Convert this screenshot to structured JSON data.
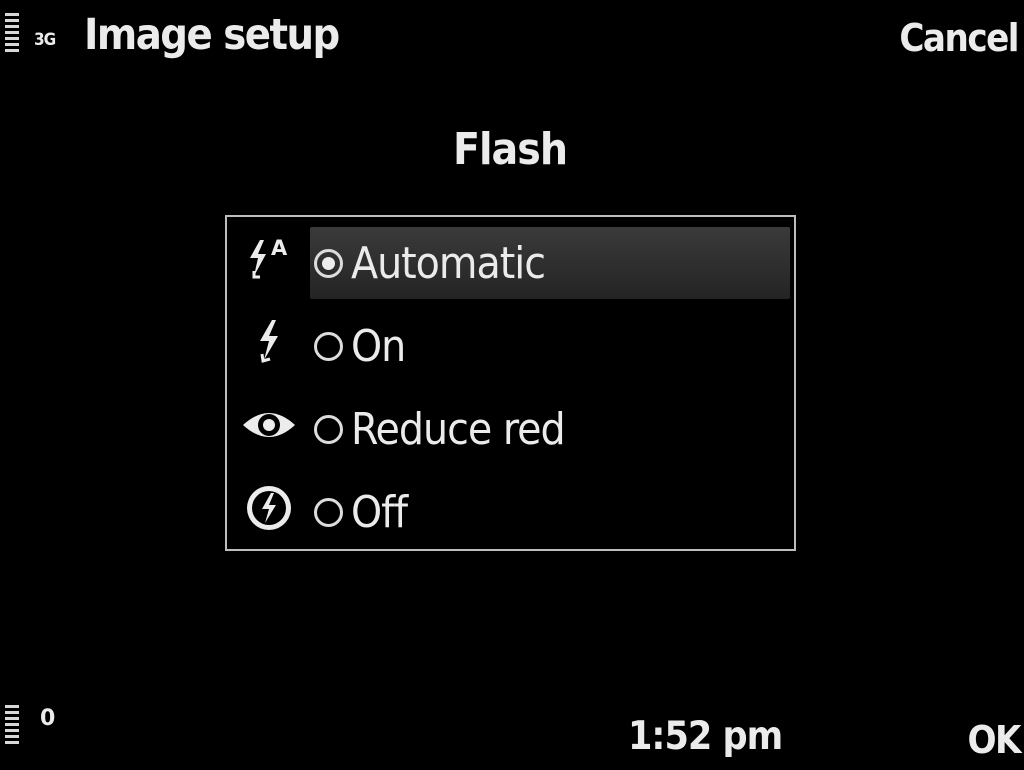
{
  "status_bar": {
    "network": "3G",
    "battery_text": "0",
    "time": "1:52 pm"
  },
  "header": {
    "title": "Image setup",
    "cancel_label": "Cancel"
  },
  "dialog": {
    "title": "Flash",
    "options": [
      {
        "label": "Automatic",
        "icon": "flash-auto-icon",
        "selected": true
      },
      {
        "label": "On",
        "icon": "flash-on-icon",
        "selected": false
      },
      {
        "label": "Reduce red",
        "icon": "red-eye-icon",
        "selected": false
      },
      {
        "label": "Off",
        "icon": "flash-off-icon",
        "selected": false
      }
    ]
  },
  "softkeys": {
    "ok_label": "OK"
  },
  "colors": {
    "background": "#000000",
    "text": "#ebebeb",
    "highlight": "#333333",
    "border": "#bdbdbd"
  }
}
